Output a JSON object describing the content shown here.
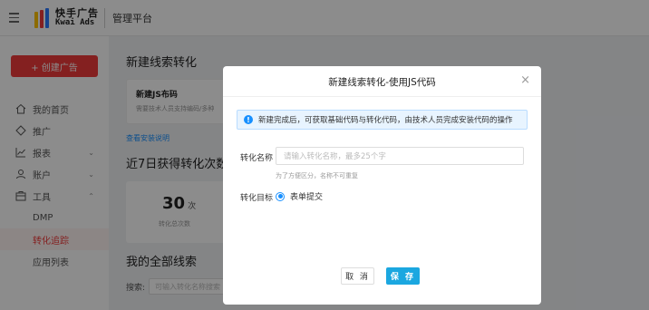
{
  "header": {
    "logo_cn": "快手广告",
    "logo_en": "Kwai Ads",
    "platform": "管理平台"
  },
  "sidebar": {
    "create_button": "+ 创建广告",
    "items": [
      {
        "label": "我的首页",
        "icon": "home-icon"
      },
      {
        "label": "推广",
        "icon": "promote-icon"
      },
      {
        "label": "报表",
        "icon": "chart-icon"
      },
      {
        "label": "账户",
        "icon": "user-icon"
      },
      {
        "label": "工具",
        "icon": "toolbox-icon"
      }
    ],
    "subitems": [
      "DMP",
      "转化追踪",
      "应用列表"
    ],
    "active_subitem": "转化追踪"
  },
  "main": {
    "title": "新建线索转化",
    "card_title": "新建JS布码",
    "card_desc": "需要技术人员支持编码/多种",
    "guide_link": "查看安装说明",
    "section2": "近7日获得转化次数",
    "stat_value": "30",
    "stat_unit": "次",
    "stat_label": "转化总次数",
    "section3": "我的全部线索",
    "search_label": "搜索:",
    "search_placeholder": "可输入转化名称搜索"
  },
  "modal": {
    "title": "新建线索转化-使用JS代码",
    "close": "×",
    "info": "新建完成后，可获取基础代码与转化代码，由技术人员完成安装代码的操作",
    "info_icon": "!",
    "name_label": "转化名称",
    "name_placeholder": "请输入转化名称，最多25个字",
    "name_hint": "为了方便区分，名称不可重复",
    "target_label": "转化目标",
    "target_option": "表单提交",
    "cancel": "取 消",
    "save": "保 存"
  },
  "colors": {
    "brand_red": "#f03b3b",
    "primary_blue": "#1890ff",
    "save_button": "#1ba7e0"
  }
}
